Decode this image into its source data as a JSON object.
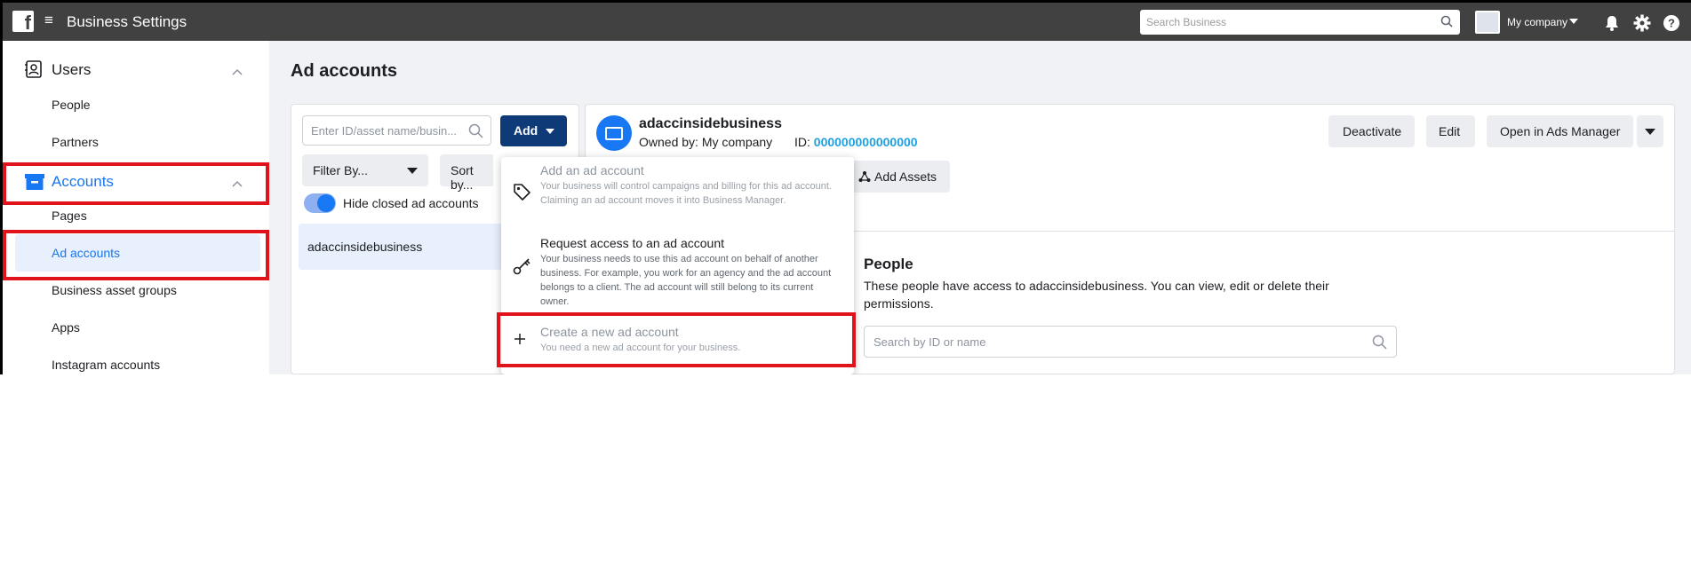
{
  "topbar": {
    "logo_letter": "f",
    "menu_glyph": "≡",
    "app_title": "Business Settings",
    "search_placeholder": "Search Business",
    "company_name": "My company",
    "icons": [
      "bell-icon",
      "gear-icon",
      "help-icon"
    ]
  },
  "sidebar": {
    "users_section": {
      "label": "Users",
      "icon": "users-icon",
      "items": [
        "People",
        "Partners"
      ]
    },
    "accounts_section": {
      "label": "Accounts",
      "icon": "accounts-icon",
      "items": [
        "Pages",
        "Ad accounts",
        "Business asset groups",
        "Apps",
        "Instagram accounts"
      ],
      "selected": "Ad accounts"
    },
    "accent_color": "#1877f2",
    "selected_bg": "#e7f0fc",
    "highlight_color": "#e0131a"
  },
  "main": {
    "page_title": "Ad accounts",
    "left_panel": {
      "search_placeholder": "Enter ID/asset name/busin...",
      "add_label": "Add",
      "filter_label": "Filter By...",
      "sort_label": "Sort by...",
      "toggle_label": "Hide closed ad accounts",
      "toggle_on": true,
      "accounts": [
        "adaccinsidebusiness"
      ]
    },
    "right_panel": {
      "account_name": "adaccinsidebusiness",
      "owned_by": "Owned by: My company",
      "id_label": "ID:",
      "id_value": "000000000000000",
      "buttons": {
        "deactivate": "Deactivate",
        "edit": "Edit",
        "open_ads_manager": "Open in Ads Manager"
      },
      "add_assets_label": "Add Assets",
      "people_title": "People",
      "people_desc": "These people have access to adaccinsidebusiness. You can view, edit or delete their permissions.",
      "people_search_placeholder": "Search by ID or name"
    },
    "dropdown": {
      "items": [
        {
          "title": "Add an ad account",
          "desc": "Your business will control campaigns and billing for this ad account. Claiming an ad account moves it into Business Manager.",
          "icon": "tag-icon",
          "disabled": true
        },
        {
          "title": "Request access to an ad account",
          "desc": "Your business needs to use this ad account on behalf of another business. For example, you work for an agency and the ad account belongs to a client. The ad account will still belong to its current owner.",
          "icon": "key-icon",
          "disabled": false
        },
        {
          "title": "Create a new ad account",
          "desc": "You need a new ad account for your business.",
          "icon": "plus-icon",
          "disabled": true
        }
      ]
    }
  },
  "colors": {
    "topbar": "#414141",
    "add_button": "#0e3a78",
    "id_link": "#1da1e0"
  }
}
